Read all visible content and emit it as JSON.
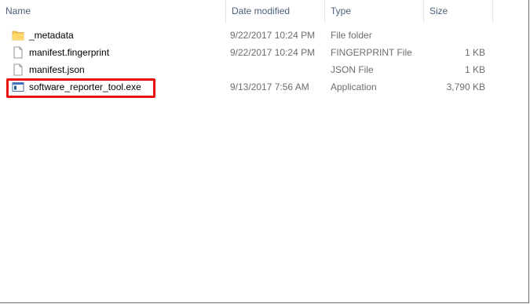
{
  "columns": {
    "name": "Name",
    "date_modified": "Date modified",
    "type": "Type",
    "size": "Size"
  },
  "files": [
    {
      "name": "_metadata",
      "date_modified": "9/22/2017 10:24 PM",
      "type": "File folder",
      "size": "",
      "icon": "folder-icon"
    },
    {
      "name": "manifest.fingerprint",
      "date_modified": "9/22/2017 10:24 PM",
      "type": "FINGERPRINT File",
      "size": "1 KB",
      "icon": "file-icon"
    },
    {
      "name": "manifest.json",
      "date_modified": "",
      "type": "JSON File",
      "size": "1 KB",
      "icon": "file-icon"
    },
    {
      "name": "software_reporter_tool.exe",
      "date_modified": "9/13/2017 7:56 AM",
      "type": "Application",
      "size": "3,790 KB",
      "icon": "application-icon"
    }
  ],
  "highlighted_item": "software_reporter_tool.exe",
  "colors": {
    "highlight": "#e8130f",
    "folder": "#f5c95a"
  }
}
